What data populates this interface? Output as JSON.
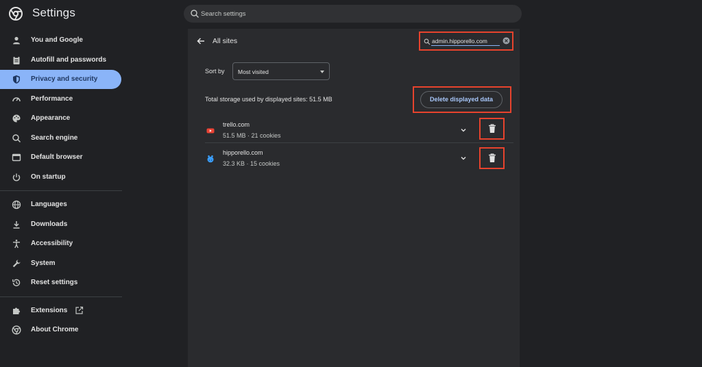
{
  "app": {
    "title": "Settings"
  },
  "search": {
    "placeholder": "Search settings"
  },
  "sidebar": {
    "items": [
      {
        "label": "You and Google",
        "icon": "person-icon"
      },
      {
        "label": "Autofill and passwords",
        "icon": "clipboard-icon"
      },
      {
        "label": "Privacy and security",
        "icon": "shield-icon",
        "active": true
      },
      {
        "label": "Performance",
        "icon": "speedometer-icon"
      },
      {
        "label": "Appearance",
        "icon": "palette-icon"
      },
      {
        "label": "Search engine",
        "icon": "search-icon"
      },
      {
        "label": "Default browser",
        "icon": "browser-icon"
      },
      {
        "label": "On startup",
        "icon": "power-icon"
      },
      {
        "label": "Languages",
        "icon": "globe-icon"
      },
      {
        "label": "Downloads",
        "icon": "download-icon"
      },
      {
        "label": "Accessibility",
        "icon": "accessibility-icon"
      },
      {
        "label": "System",
        "icon": "wrench-icon"
      },
      {
        "label": "Reset settings",
        "icon": "history-icon"
      },
      {
        "label": "Extensions",
        "icon": "puzzle-icon"
      },
      {
        "label": "About Chrome",
        "icon": "chrome-icon"
      }
    ]
  },
  "main": {
    "title": "All sites",
    "filter_value": "admin.hipporello.com",
    "sort_label": "Sort by",
    "sort_value": "Most visited",
    "storage_text": "Total storage used by displayed sites: 51.5 MB",
    "delete_label": "Delete displayed data",
    "sites": [
      {
        "name": "trello.com",
        "meta": "51.5 MB · 21 cookies",
        "icon": "youtube-style-favicon"
      },
      {
        "name": "hipporello.com",
        "meta": "32.3 KB · 15 cookies",
        "icon": "hippo-favicon"
      }
    ]
  },
  "colors": {
    "accent": "#8ab4f8",
    "highlight_border": "#e8432d",
    "background": "#202124",
    "panel": "#2a2b2e"
  }
}
